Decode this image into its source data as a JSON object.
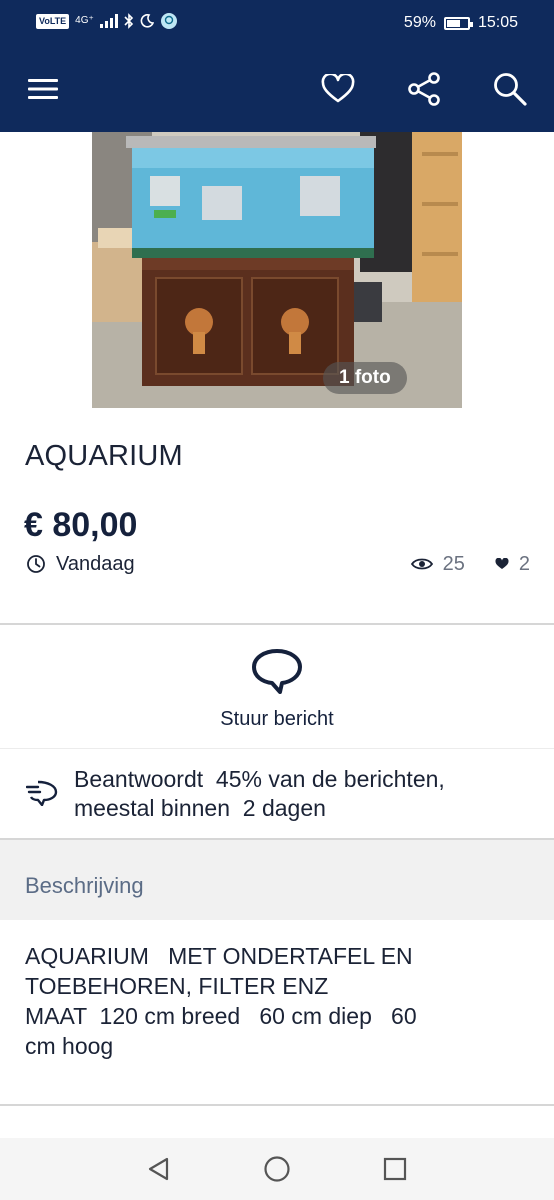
{
  "status_bar": {
    "network_badge": "VoLTE",
    "network_type": "4G⁺",
    "battery_label": "59%",
    "battery_level": 0.59,
    "time": "15:05"
  },
  "app_bar": {
    "icons": [
      "menu-icon",
      "heart-icon",
      "share-icon",
      "search-icon"
    ],
    "background_color": "#0f2a5c"
  },
  "listing": {
    "photo_count_label": "1 foto",
    "title": "AQUARIUM",
    "price": "€ 80,00",
    "posted": "Vandaag",
    "views": "25",
    "favorites": "2"
  },
  "contact": {
    "send_message_label": "Stuur bericht",
    "response_rate_text": "Beantwoordt  45% van de berichten,\nmeestal binnen  2 dagen"
  },
  "description": {
    "header": "Beschrijving",
    "body": "AQUARIUM   MET ONDERTAFEL EN\nTOEBEHOREN, FILTER ENZ\nMAAT  120 cm breed   60 cm diep   60\ncm hoog"
  },
  "nav_bar": {
    "icons": [
      "back-icon",
      "home-icon",
      "recents-icon"
    ]
  }
}
